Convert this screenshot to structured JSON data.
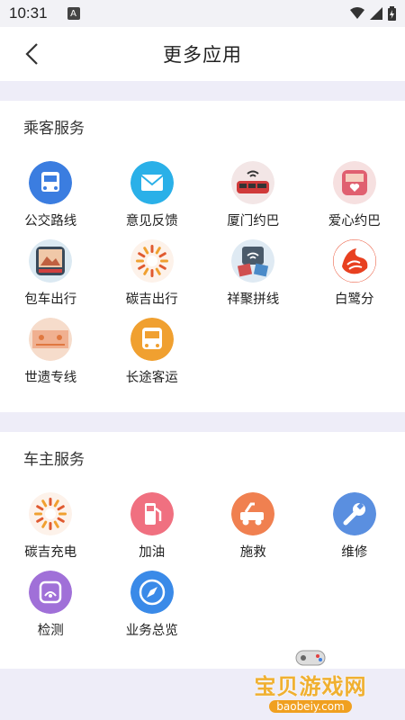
{
  "status_bar": {
    "time": "10:31",
    "badge": "A"
  },
  "header": {
    "title": "更多应用"
  },
  "sections": [
    {
      "title": "乘客服务",
      "items": [
        {
          "label": "公交路线",
          "icon": "bus-route-icon",
          "color": "#3b7de0"
        },
        {
          "label": "意见反馈",
          "icon": "feedback-envelope-icon",
          "color": "#2ab0e8"
        },
        {
          "label": "厦门约巴",
          "icon": "xiamen-bus-icon",
          "color": "#d03a3a"
        },
        {
          "label": "爱心约巴",
          "icon": "love-bus-icon",
          "color": "#e06070"
        },
        {
          "label": "包车出行",
          "icon": "charter-bus-icon",
          "color": "#5aa0c8"
        },
        {
          "label": "碳吉出行",
          "icon": "carbon-sun-icon",
          "color": "#e05a30"
        },
        {
          "label": "祥聚拼线",
          "icon": "shared-route-icon",
          "color": "#4a8ac8"
        },
        {
          "label": "白鹭分",
          "icon": "egret-score-icon",
          "color": "#e84020"
        },
        {
          "label": "世遗专线",
          "icon": "heritage-line-icon",
          "color": "#e07840"
        },
        {
          "label": "长途客运",
          "icon": "coach-icon",
          "color": "#f0a030"
        }
      ]
    },
    {
      "title": "车主服务",
      "items": [
        {
          "label": "碳吉充电",
          "icon": "carbon-charge-icon",
          "color": "#e05a30"
        },
        {
          "label": "加油",
          "icon": "fuel-icon",
          "color": "#f07080"
        },
        {
          "label": "施救",
          "icon": "tow-truck-icon",
          "color": "#f08050"
        },
        {
          "label": "维修",
          "icon": "wrench-icon",
          "color": "#5a8fe0"
        },
        {
          "label": "检测",
          "icon": "inspection-icon",
          "color": "#a070d8"
        },
        {
          "label": "业务总览",
          "icon": "compass-icon",
          "color": "#3a8ae8"
        }
      ]
    }
  ],
  "watermark": {
    "text": "宝贝游戏网",
    "url": "baobeiy.com"
  }
}
